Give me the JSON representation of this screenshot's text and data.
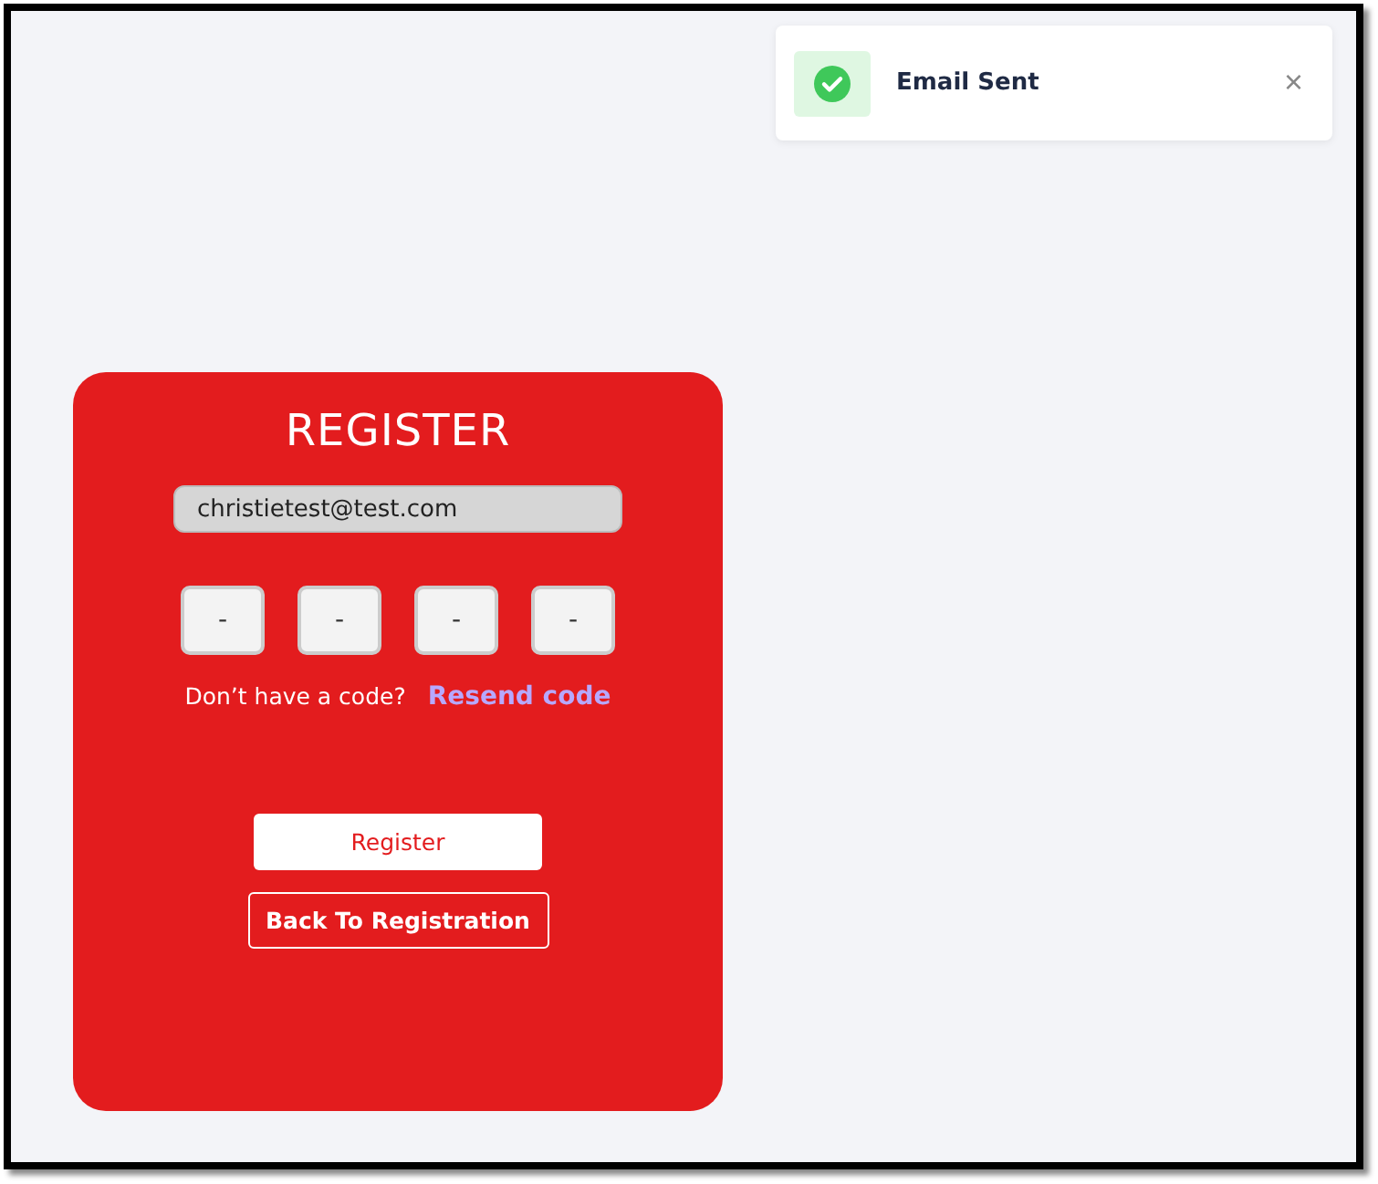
{
  "toast": {
    "message": "Email Sent",
    "close": "×"
  },
  "form": {
    "title": "REGISTER",
    "email": "christietest@test.com",
    "code_digits": [
      "-",
      "-",
      "-",
      "-"
    ],
    "prompt": "Don’t have a code?",
    "resend": "Resend code",
    "buttons": [
      {
        "kind": "primary",
        "label": "Register"
      },
      {
        "kind": "outline",
        "label": "Back To Registration"
      }
    ]
  }
}
